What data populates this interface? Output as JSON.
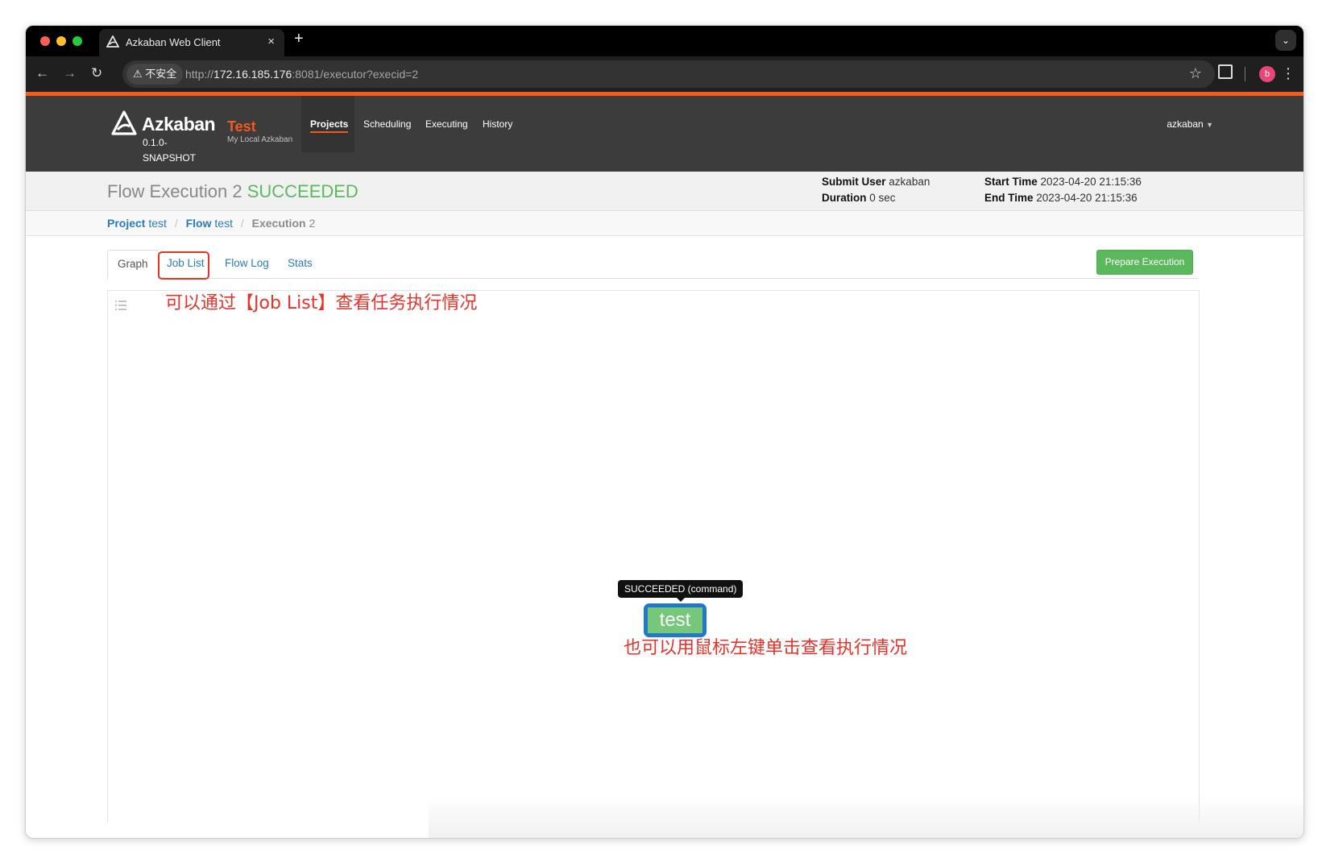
{
  "browser": {
    "tab_title": "Azkaban Web Client",
    "new_tab_label": "+",
    "close_label": "×",
    "security_label": "不安全",
    "url_scheme": "http://",
    "url_host": "172.16.185.176",
    "url_rest": ":8081/executor?execid=2",
    "profile_initial": "b"
  },
  "app": {
    "brand": "Azkaban",
    "version": "0.1.0-SNAPSHOT",
    "env_name": "Test",
    "env_subtitle": "My Local Azkaban",
    "nav": [
      "Projects",
      "Scheduling",
      "Executing",
      "History"
    ],
    "active_nav": "Projects",
    "user": "azkaban",
    "accent_color": "#f35a1d"
  },
  "execution": {
    "title_prefix": "Flow Execution",
    "exec_id": "2",
    "status": "SUCCEEDED",
    "submit_user_label": "Submit User",
    "submit_user": "azkaban",
    "duration_label": "Duration",
    "duration": "0 sec",
    "start_time_label": "Start Time",
    "start_time": "2023-04-20 21:15:36",
    "end_time_label": "End Time",
    "end_time": "2023-04-20 21:15:36"
  },
  "breadcrumb": {
    "project_label": "Project",
    "project": "test",
    "flow_label": "Flow",
    "flow": "test",
    "execution_label": "Execution",
    "execution": "2",
    "separator": "/"
  },
  "tabs": {
    "graph": "Graph",
    "job_list": "Job List",
    "flow_log": "Flow Log",
    "stats": "Stats",
    "prepare_execution": "Prepare Execution"
  },
  "graph": {
    "node_label": "test",
    "node_tooltip": "SUCCEEDED (command)",
    "annotation_top": "可以通过【Job List】查看任务执行情况",
    "annotation_bottom": "也可以用鼠标左键单击查看执行情况"
  }
}
